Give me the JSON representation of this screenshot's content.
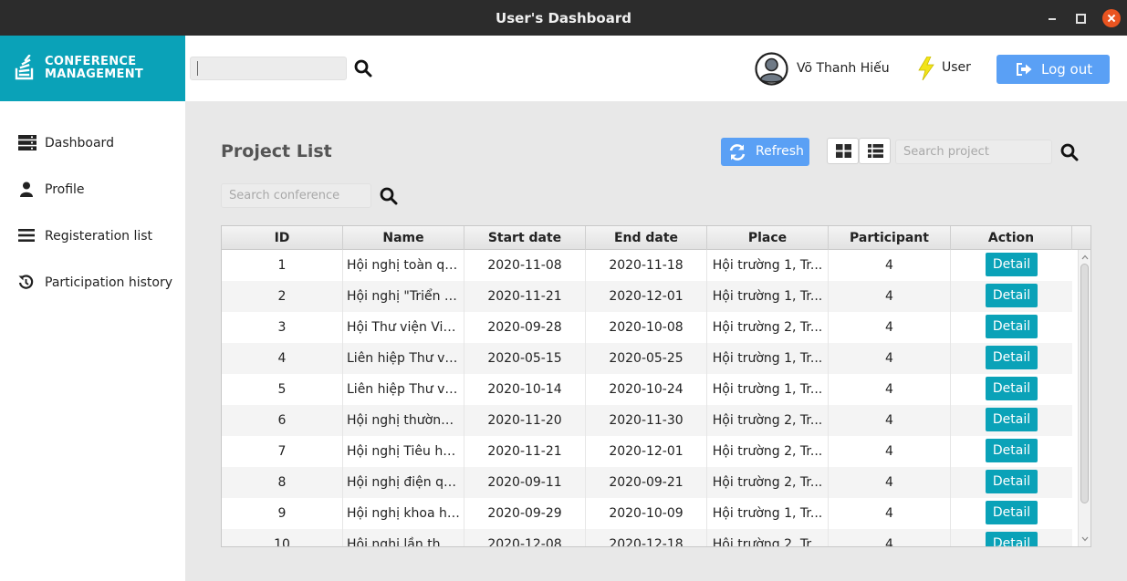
{
  "window": {
    "title": "User's Dashboard"
  },
  "logo": {
    "line1": "CONFERENCE",
    "line2": "MANAGEMENT"
  },
  "header": {
    "search_value": "",
    "username": "Võ Thanh Hiếu",
    "role": "User",
    "logout_label": "Log out"
  },
  "sidebar": {
    "items": [
      {
        "label": "Dashboard",
        "icon": "server-icon"
      },
      {
        "label": "Profile",
        "icon": "user-icon"
      },
      {
        "label": "Registeration list",
        "icon": "list-icon"
      },
      {
        "label": "Participation history",
        "icon": "history-icon"
      }
    ]
  },
  "main": {
    "title": "Project List",
    "refresh_label": "Refresh",
    "search_project_placeholder": "Search project",
    "search_conference_placeholder": "Search conference"
  },
  "table": {
    "columns": [
      "ID",
      "Name",
      "Start date",
      "End date",
      "Place",
      "Participant",
      "Action"
    ],
    "action_label": "Detail",
    "rows": [
      {
        "id": "1",
        "name": "Hội nghị toàn qu...",
        "start": "2020-11-08",
        "end": "2020-11-18",
        "place": "Hội trường 1, Tr...",
        "participant": "4"
      },
      {
        "id": "2",
        "name": "Hội nghị \"Triển k...",
        "start": "2020-11-21",
        "end": "2020-12-01",
        "place": "Hội trường 1, Tr...",
        "participant": "4"
      },
      {
        "id": "3",
        "name": "Hội Thư viện Việ...",
        "start": "2020-09-28",
        "end": "2020-10-08",
        "place": "Hội trường 2, Tr...",
        "participant": "4"
      },
      {
        "id": "4",
        "name": "Liên hiệp Thư vi...",
        "start": "2020-05-15",
        "end": "2020-05-25",
        "place": "Hội trường 1, Tr...",
        "participant": "4"
      },
      {
        "id": "5",
        "name": "Liên hiệp Thư vi...",
        "start": "2020-10-14",
        "end": "2020-10-24",
        "place": "Hội trường 1, Tr...",
        "participant": "4"
      },
      {
        "id": "6",
        "name": "Hội nghị thường ...",
        "start": "2020-11-20",
        "end": "2020-11-30",
        "place": "Hội trường 2, Tr...",
        "participant": "4"
      },
      {
        "id": "7",
        "name": "Hội nghị Tiêu hó...",
        "start": "2020-11-21",
        "end": "2020-12-01",
        "place": "Hội trường 2, Tr...",
        "participant": "4"
      },
      {
        "id": "8",
        "name": "Hội nghị điện qu...",
        "start": "2020-09-11",
        "end": "2020-09-21",
        "place": "Hội trường 2, Tr...",
        "participant": "4"
      },
      {
        "id": "9",
        "name": "Hội nghị khoa họ...",
        "start": "2020-09-29",
        "end": "2020-10-09",
        "place": "Hội trường 1, Tr...",
        "participant": "4"
      },
      {
        "id": "10",
        "name": "Hội nghị lần thứ...",
        "start": "2020-12-08",
        "end": "2020-12-18",
        "place": "Hội trường 2, Tr...",
        "participant": "4"
      }
    ]
  },
  "colors": {
    "accent": "#0aa2b8",
    "button_blue": "#5aa0f5",
    "titlebar": "#2c2c2c",
    "close": "#e95420"
  }
}
